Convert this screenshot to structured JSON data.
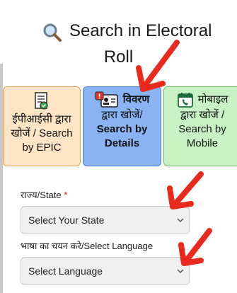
{
  "header": {
    "title_line1": "Search in Electoral",
    "title_line2": "Roll"
  },
  "tabs": [
    {
      "line1": "ईपीआईसी द्वारा",
      "line2": "खोजें / Search",
      "line3": "by EPIC"
    },
    {
      "line1": "विवरण",
      "line2": "द्वारा खोजें/",
      "line3": "Search by",
      "line4": "Details"
    },
    {
      "line1": "मोबाइल",
      "line2": "द्वारा खोजें /",
      "line3": "Search by",
      "line4": "Mobile"
    }
  ],
  "form": {
    "state_label": "राज्य/State",
    "state_required": "*",
    "state_value": "Select Your State",
    "language_label": "भाषा का चयन करे/Select Language",
    "language_value": "Select Language"
  },
  "colors": {
    "annotation_arrow": "#e8291c",
    "tab_epic_bg": "#fde4c4",
    "tab_details_bg": "#89b3f2",
    "tab_mobile_bg": "#c8f2c4"
  }
}
